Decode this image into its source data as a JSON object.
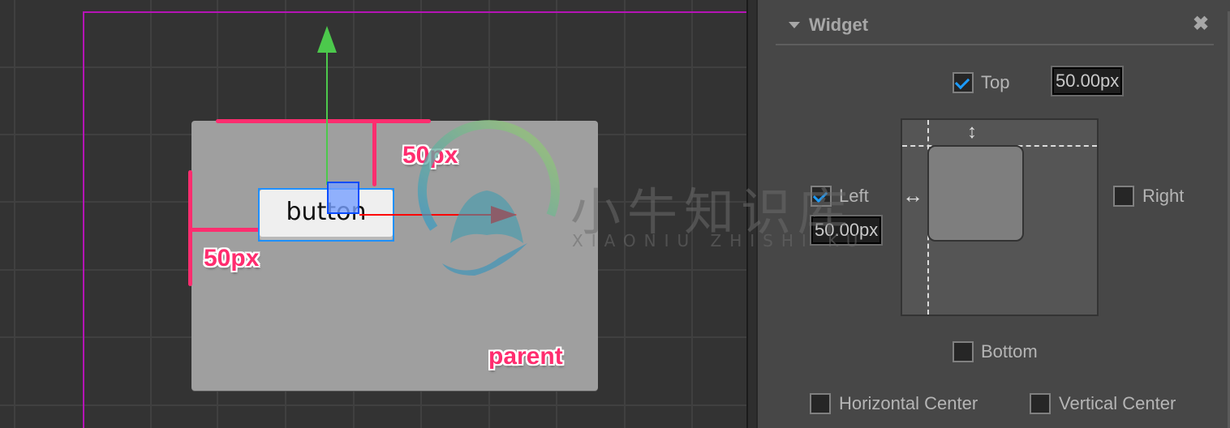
{
  "scene": {
    "annotations": {
      "top_distance": "50px",
      "left_distance": "50px",
      "parent_label": "parent"
    },
    "button": {
      "label": "button"
    },
    "gizmo": {
      "x_axis_color": "#ff0000",
      "y_axis_color": "#4cc94c"
    },
    "highlight_color": "#ff2d6f",
    "selection_color": "#1e90ff"
  },
  "watermark": {
    "chinese": "小牛知识库",
    "pinyin": "XIAONIU ZHISHI KU"
  },
  "panel": {
    "title": "Widget",
    "close_icon": "close-icon",
    "collapse_icon": "caret-down-icon",
    "top": {
      "label": "Top",
      "checked": true,
      "value": "50.00px"
    },
    "left": {
      "label": "Left",
      "checked": true,
      "value": "50.00px"
    },
    "right": {
      "label": "Right",
      "checked": false
    },
    "bottom": {
      "label": "Bottom",
      "checked": false
    },
    "horizontal_center": {
      "label": "Horizontal Center",
      "checked": false
    },
    "vertical_center": {
      "label": "Vertical Center",
      "checked": false
    },
    "check_color": "#1c9cff"
  }
}
